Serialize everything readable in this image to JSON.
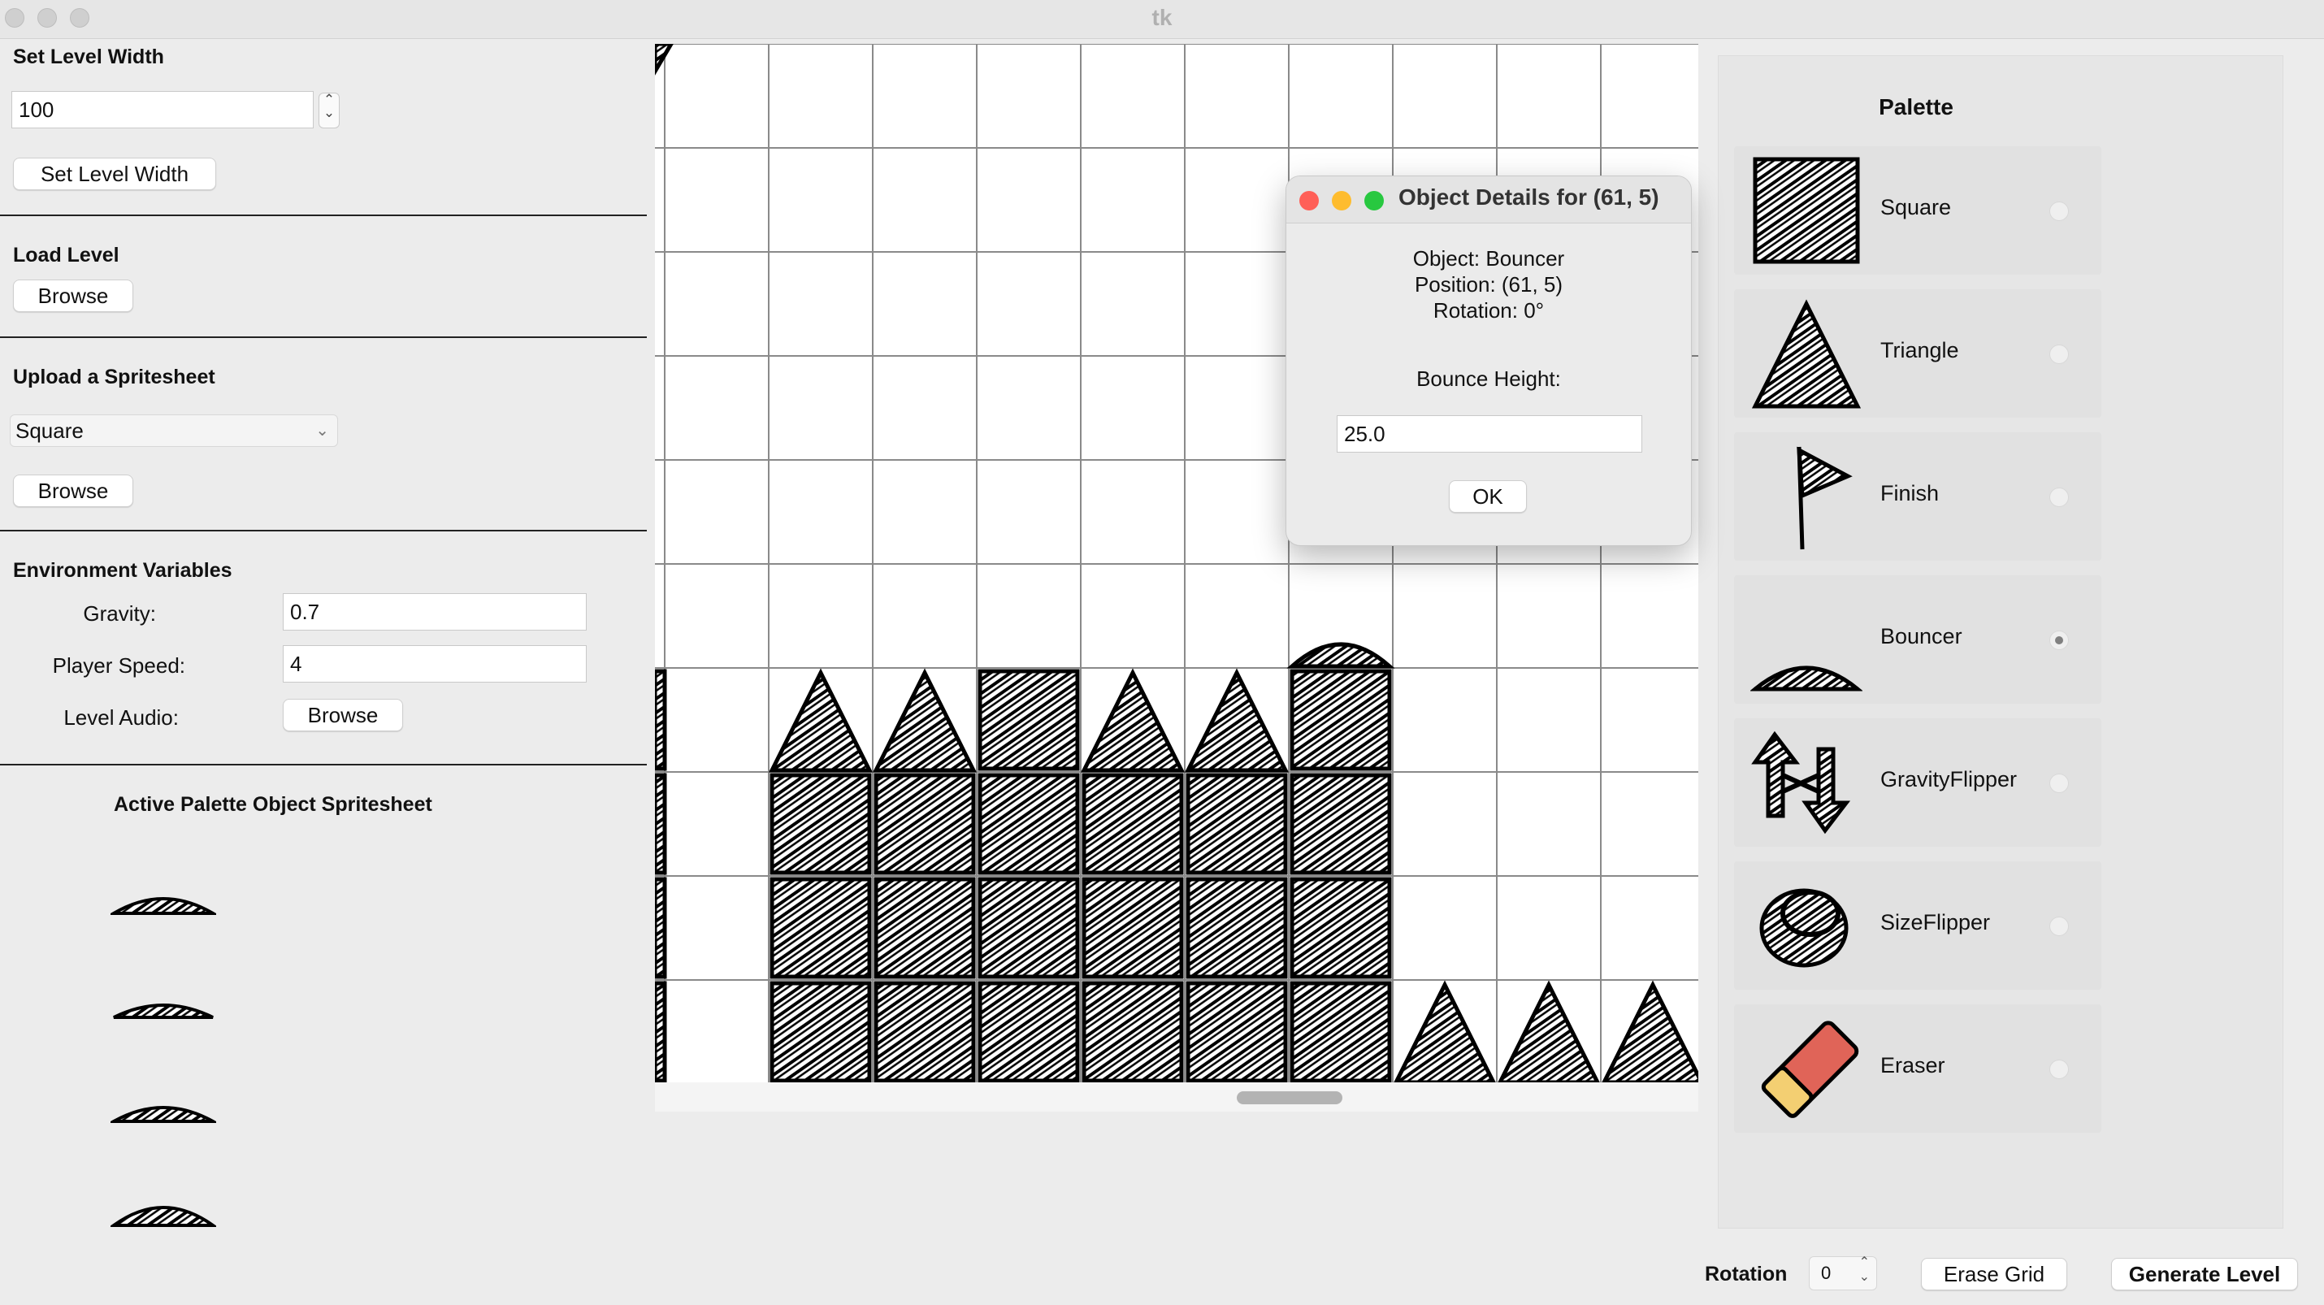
{
  "window": {
    "title": "tk"
  },
  "left": {
    "set_width_title": "Set Level Width",
    "width_value": "100",
    "set_width_button": "Set Level Width",
    "load_title": "Load Level",
    "load_browse": "Browse",
    "upload_title": "Upload a Spritesheet",
    "sprite_select_value": "Square",
    "upload_browse": "Browse",
    "env_title": "Environment Variables",
    "gravity_label": "Gravity:",
    "gravity_value": "0.7",
    "speed_label": "Player Speed:",
    "speed_value": "4",
    "audio_label": "Level Audio:",
    "audio_browse": "Browse",
    "active_title": "Active Palette Object Spritesheet"
  },
  "grid": {
    "columns": 10,
    "rows": 10,
    "cells": [
      {
        "col": 0,
        "row": 0,
        "type": "partial-triangle"
      },
      {
        "col": 0,
        "row": 6,
        "type": "partial-square"
      },
      {
        "col": 1,
        "row": 6,
        "type": "triangle"
      },
      {
        "col": 2,
        "row": 6,
        "type": "triangle"
      },
      {
        "col": 3,
        "row": 6,
        "type": "square"
      },
      {
        "col": 4,
        "row": 6,
        "type": "triangle"
      },
      {
        "col": 5,
        "row": 6,
        "type": "triangle"
      },
      {
        "col": 6,
        "row": 6,
        "type": "square"
      },
      {
        "col": 6,
        "row": 5,
        "type": "bouncer"
      },
      {
        "col": 0,
        "row": 7,
        "type": "partial-square"
      },
      {
        "col": 1,
        "row": 7,
        "type": "square"
      },
      {
        "col": 2,
        "row": 7,
        "type": "square"
      },
      {
        "col": 3,
        "row": 7,
        "type": "square"
      },
      {
        "col": 4,
        "row": 7,
        "type": "square"
      },
      {
        "col": 5,
        "row": 7,
        "type": "square"
      },
      {
        "col": 6,
        "row": 7,
        "type": "square"
      },
      {
        "col": 0,
        "row": 8,
        "type": "partial-square"
      },
      {
        "col": 1,
        "row": 8,
        "type": "square"
      },
      {
        "col": 2,
        "row": 8,
        "type": "square"
      },
      {
        "col": 3,
        "row": 8,
        "type": "square"
      },
      {
        "col": 4,
        "row": 8,
        "type": "square"
      },
      {
        "col": 5,
        "row": 8,
        "type": "square"
      },
      {
        "col": 6,
        "row": 8,
        "type": "square"
      },
      {
        "col": 0,
        "row": 9,
        "type": "partial-square"
      },
      {
        "col": 1,
        "row": 9,
        "type": "square"
      },
      {
        "col": 2,
        "row": 9,
        "type": "square"
      },
      {
        "col": 3,
        "row": 9,
        "type": "square"
      },
      {
        "col": 4,
        "row": 9,
        "type": "square"
      },
      {
        "col": 5,
        "row": 9,
        "type": "square"
      },
      {
        "col": 6,
        "row": 9,
        "type": "square"
      },
      {
        "col": 7,
        "row": 9,
        "type": "triangle"
      },
      {
        "col": 8,
        "row": 9,
        "type": "triangle"
      },
      {
        "col": 9,
        "row": 9,
        "type": "triangle"
      },
      {
        "col": 10,
        "row": 9,
        "type": "triangle"
      }
    ]
  },
  "dialog": {
    "title": "Object Details for (61, 5)",
    "object_line": "Object: Bouncer",
    "position_line": "Position: (61, 5)",
    "rotation_line": "Rotation: 0°",
    "bounce_label": "Bounce Height:",
    "bounce_value": "25.0",
    "ok_label": "OK"
  },
  "palette": {
    "title": "Palette",
    "selected": "Bouncer",
    "items": [
      {
        "label": "Square",
        "icon": "square-icon"
      },
      {
        "label": "Triangle",
        "icon": "triangle-icon"
      },
      {
        "label": "Finish",
        "icon": "flag-icon"
      },
      {
        "label": "Bouncer",
        "icon": "bouncer-icon"
      },
      {
        "label": "GravityFlipper",
        "icon": "gravity-flipper-icon"
      },
      {
        "label": "SizeFlipper",
        "icon": "size-flipper-icon"
      },
      {
        "label": "Eraser",
        "icon": "eraser-icon"
      }
    ]
  },
  "bottom": {
    "rotation_label": "Rotation",
    "rotation_value": "0",
    "erase_grid": "Erase Grid",
    "generate_level": "Generate Level"
  },
  "colors": {
    "dialog_close": "#ff5f57",
    "dialog_minimize": "#febc2e",
    "dialog_zoom": "#28c840",
    "eraser_body": "#e06458",
    "eraser_tip": "#f3cf72"
  }
}
